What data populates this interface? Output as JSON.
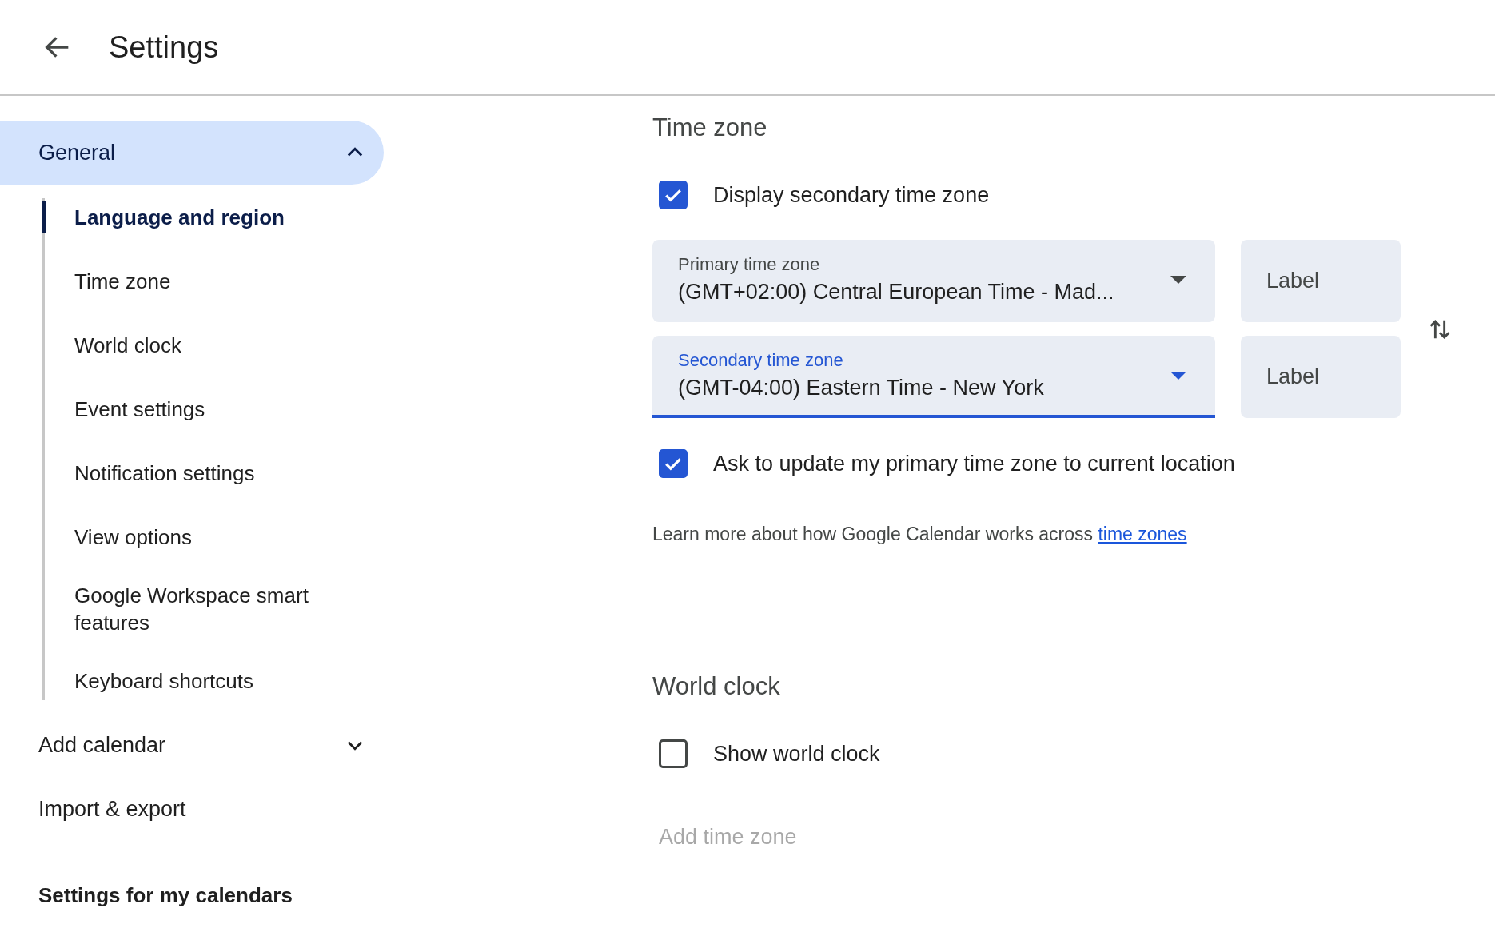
{
  "header": {
    "title": "Settings"
  },
  "sidebar": {
    "items": [
      {
        "kind": "group",
        "label": "General",
        "selected": true,
        "expanded": true,
        "children": [
          {
            "label": "Language and region",
            "selected": true
          },
          {
            "label": "Time zone",
            "selected": false
          },
          {
            "label": "World clock",
            "selected": false
          },
          {
            "label": "Event settings",
            "selected": false
          },
          {
            "label": "Notification settings",
            "selected": false
          },
          {
            "label": "View options",
            "selected": false
          },
          {
            "label": "Google Workspace smart features",
            "selected": false
          },
          {
            "label": "Keyboard shortcuts",
            "selected": false
          }
        ]
      },
      {
        "kind": "group",
        "label": "Add calendar",
        "selected": false,
        "expanded": false
      },
      {
        "kind": "link",
        "label": "Import & export",
        "selected": false
      }
    ],
    "section_heading": "Settings for my calendars"
  },
  "time_zone": {
    "heading": "Time zone",
    "display_secondary": {
      "label": "Display secondary time zone",
      "checked": true
    },
    "selects": [
      {
        "field_label": "Primary time zone",
        "value": "(GMT+02:00) Central European Time - Mad...",
        "focused": false,
        "label_placeholder": "Label"
      },
      {
        "field_label": "Secondary time zone",
        "value": "(GMT-04:00) Eastern Time - New York",
        "focused": true,
        "label_placeholder": "Label"
      }
    ],
    "ask_update": {
      "label": "Ask to update my primary time zone to current location",
      "checked": true
    },
    "learn_more": {
      "text": "Learn more about how Google Calendar works across",
      "link": "time zones"
    }
  },
  "world_clock": {
    "heading": "World clock",
    "show": {
      "label": "Show world clock",
      "checked": false
    },
    "add_time_zone": {
      "label": "Add time zone",
      "disabled": true
    }
  }
}
